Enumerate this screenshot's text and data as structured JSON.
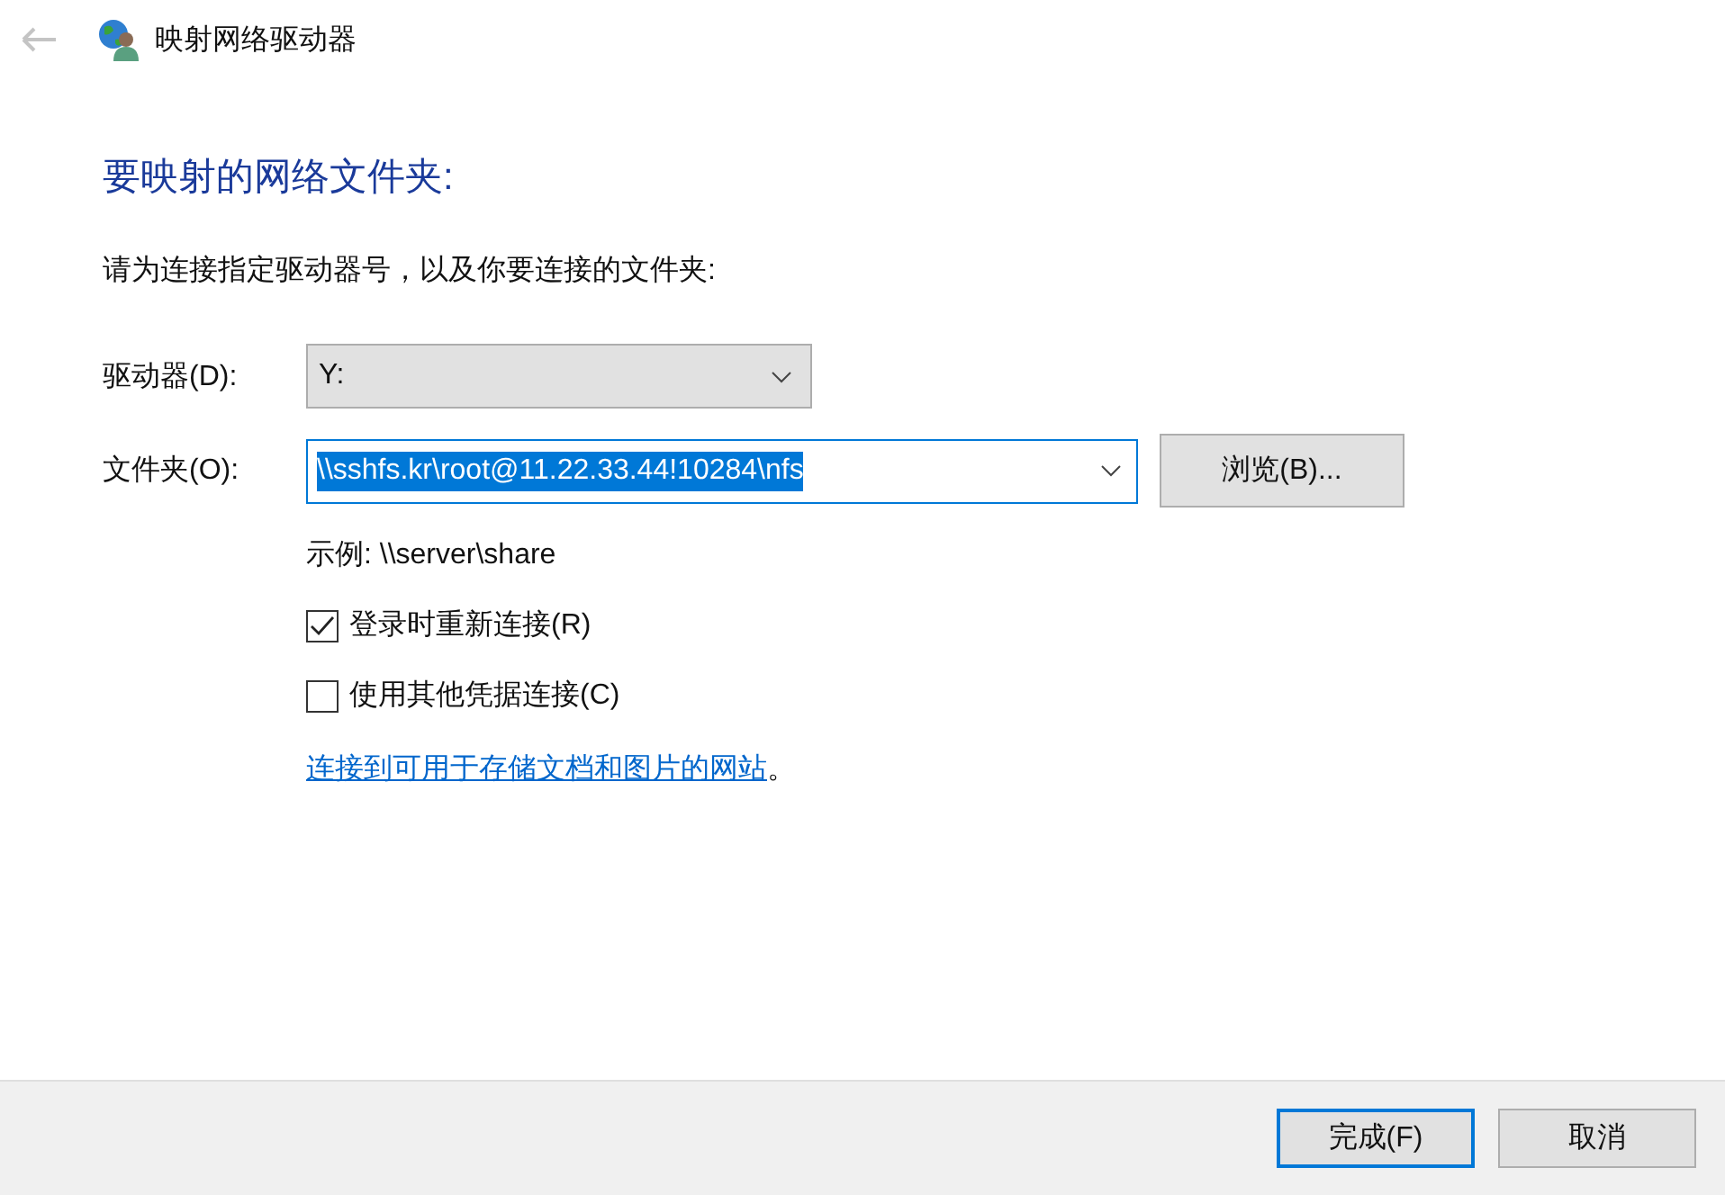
{
  "window": {
    "title": "映射网络驱动器"
  },
  "heading": "要映射的网络文件夹:",
  "instruction": "请为连接指定驱动器号，以及你要连接的文件夹:",
  "drive": {
    "label": "驱动器(D):",
    "value": "Y:"
  },
  "folder": {
    "label": "文件夹(O):",
    "value": "\\\\sshfs.kr\\root@11.22.33.44!10284\\nfs",
    "selected": true
  },
  "browse_button": "浏览(B)...",
  "example": "示例: \\\\server\\share",
  "checkboxes": [
    {
      "label": "登录时重新连接(R)",
      "checked": true
    },
    {
      "label": "使用其他凭据连接(C)",
      "checked": false
    }
  ],
  "link": {
    "text": "连接到可用于存储文档和图片的网站",
    "suffix": "。"
  },
  "buttons": [
    {
      "label": "完成(F)",
      "default": true
    },
    {
      "label": "取消",
      "default": false
    }
  ]
}
